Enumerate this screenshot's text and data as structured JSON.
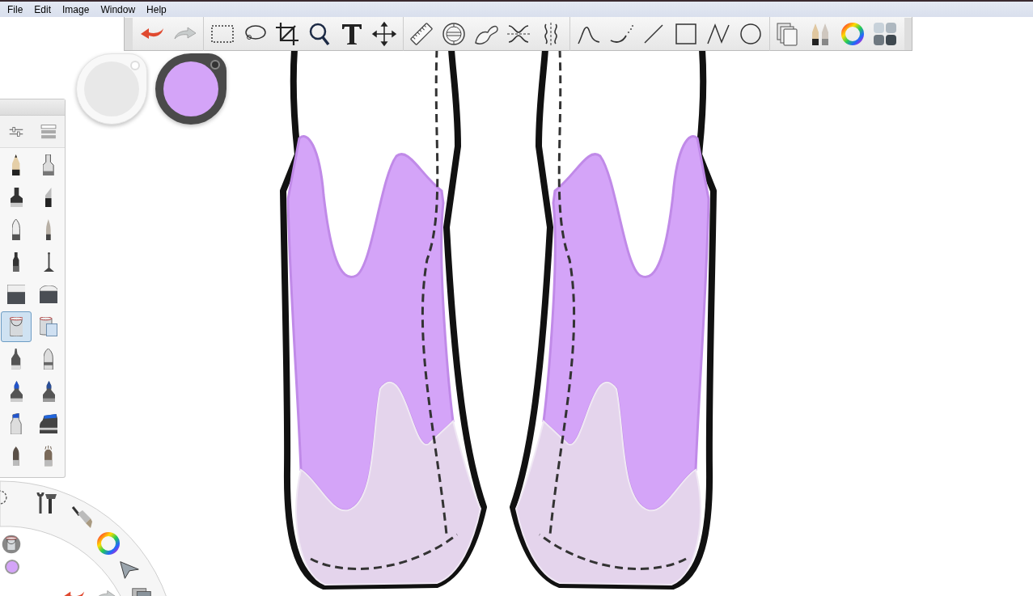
{
  "menu": [
    {
      "label": "File"
    },
    {
      "label": "Edit"
    },
    {
      "label": "Image"
    },
    {
      "label": "Window"
    },
    {
      "label": "Help"
    }
  ],
  "color_pucks": [
    {
      "color": "#e8e8e8",
      "selected": false
    },
    {
      "color": "#d4a4f8",
      "selected": true
    }
  ],
  "brushes": [
    {
      "kind": "pencil",
      "selected": false
    },
    {
      "kind": "technical-pen",
      "selected": false
    },
    {
      "kind": "marker",
      "selected": false
    },
    {
      "kind": "chisel-marker",
      "selected": false
    },
    {
      "kind": "ballpoint",
      "selected": false
    },
    {
      "kind": "round-brush",
      "selected": false
    },
    {
      "kind": "felt-pen",
      "selected": false
    },
    {
      "kind": "airbrush",
      "selected": false
    },
    {
      "kind": "hard-eraser",
      "selected": false
    },
    {
      "kind": "soft-eraser",
      "selected": false
    },
    {
      "kind": "paint-bucket",
      "selected": true
    },
    {
      "kind": "layer-bucket",
      "selected": false
    },
    {
      "kind": "fine-marker",
      "selected": false
    },
    {
      "kind": "bullet-marker",
      "selected": false
    },
    {
      "kind": "tipped-marker",
      "selected": false
    },
    {
      "kind": "dual-tip-marker",
      "selected": false
    },
    {
      "kind": "wide-marker",
      "selected": false
    },
    {
      "kind": "block-marker",
      "selected": false
    },
    {
      "kind": "flat-brush",
      "selected": false
    },
    {
      "kind": "bristle-brush",
      "selected": false
    }
  ]
}
